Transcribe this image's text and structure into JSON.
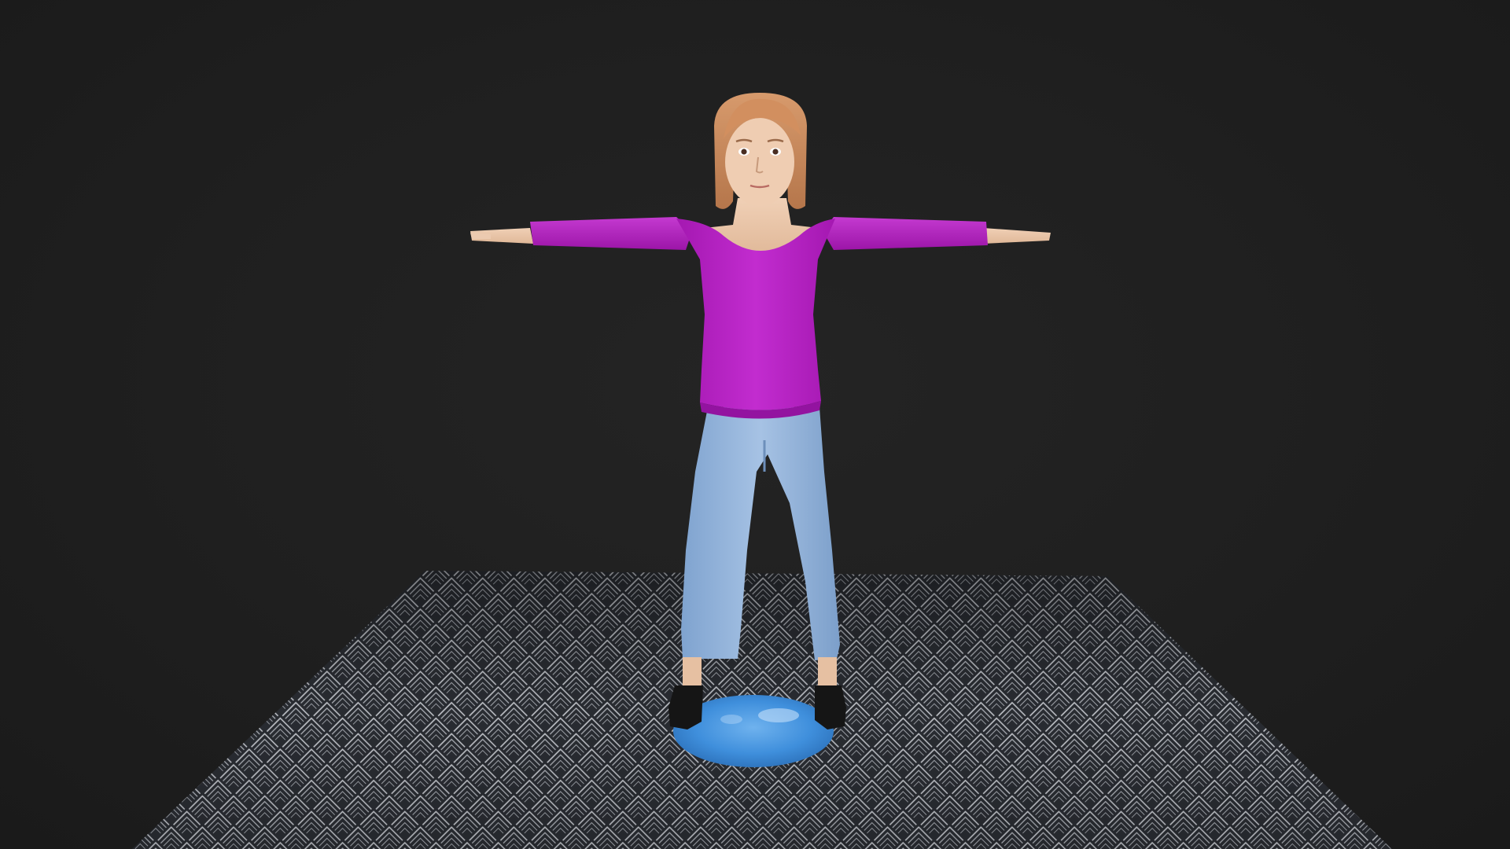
{
  "scene": {
    "background_color": "#1f1f1f",
    "floor": {
      "base_color": "#2a2d33",
      "pattern_color": "#c9ccd2",
      "pattern": "nested-chevron-tiles"
    },
    "base_disc": {
      "color": "#3f8fdc",
      "highlight_color": "#a9d2f5"
    },
    "character": {
      "pose": "T-pose",
      "hair_color": "#c98a5c",
      "skin_color": "#e8c3a6",
      "sweater_color": "#b51fc0",
      "pants_color": "#8fb3dc",
      "shoe_color": "#151515"
    }
  }
}
